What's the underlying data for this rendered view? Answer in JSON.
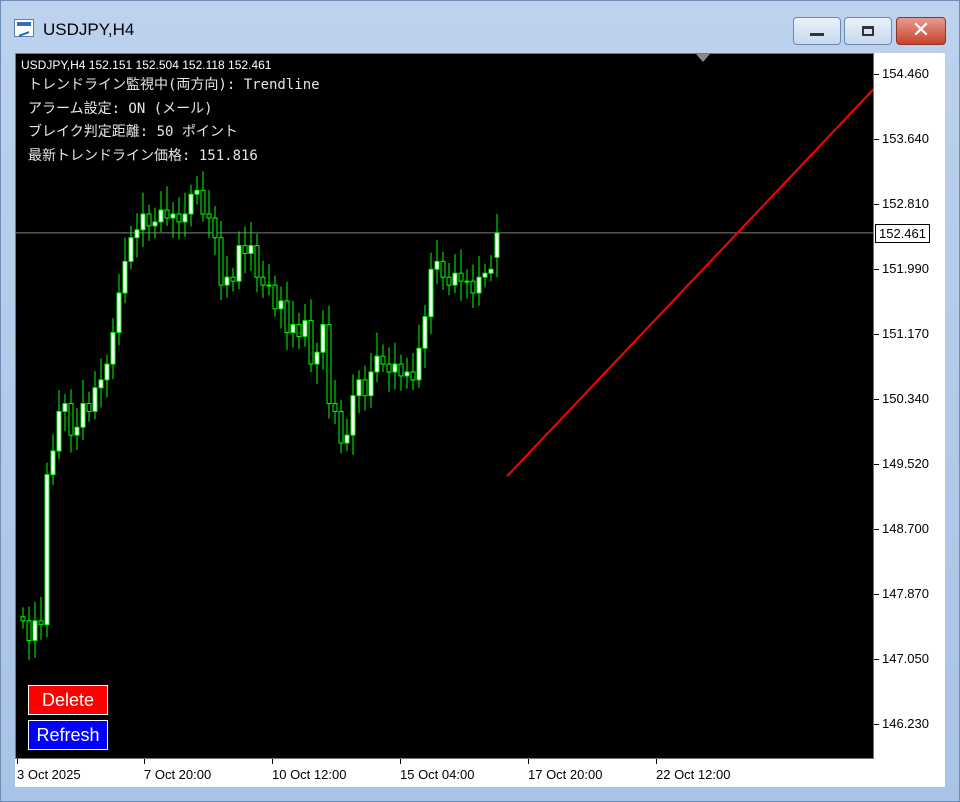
{
  "window": {
    "title": "USDJPY,H4",
    "close_glyph": "✕"
  },
  "chart": {
    "header": "USDJPY,H4  152.151 152.504 152.118 152.461",
    "info_lines": [
      "トレンドライン監視中(両方向): Trendline",
      "アラーム設定: ON (メール)",
      "ブレイク判定距離: 50 ポイント",
      "最新トレンドライン価格: 151.816"
    ],
    "buttons": {
      "delete": "Delete",
      "refresh": "Refresh"
    },
    "price_labels": [
      "154.460",
      "153.640",
      "152.810",
      "152.461",
      "151.990",
      "151.170",
      "150.340",
      "149.520",
      "148.700",
      "147.870",
      "147.050",
      "146.230"
    ],
    "current_price": "152.461",
    "time_labels": [
      "3 Oct 2025",
      "7 Oct 20:00",
      "10 Oct 12:00",
      "15 Oct 04:00",
      "17 Oct 20:00",
      "22 Oct 12:00"
    ],
    "colors": {
      "background": "#000000",
      "candle": "#00ff00",
      "bull_body": "#ffffff",
      "trendline": "#ff0000",
      "price_line": "#808080"
    }
  },
  "chart_data": {
    "type": "candlestick",
    "symbol": "USDJPY",
    "timeframe": "H4",
    "ohlc_last": {
      "open": 152.151,
      "high": 152.504,
      "low": 152.118,
      "close": 152.461
    },
    "ylim": [
      146.0,
      154.6
    ],
    "closes": [
      147.55,
      147.3,
      147.55,
      147.5,
      149.4,
      149.7,
      150.2,
      150.3,
      149.9,
      150.0,
      150.3,
      150.2,
      150.5,
      150.6,
      150.8,
      151.2,
      151.7,
      152.1,
      152.4,
      152.5,
      152.7,
      152.55,
      152.6,
      152.75,
      152.65,
      152.7,
      152.6,
      152.7,
      152.95,
      153.0,
      152.7,
      152.65,
      152.4,
      151.8,
      151.9,
      151.85,
      152.3,
      152.2,
      152.3,
      151.9,
      151.8,
      151.8,
      151.5,
      151.6,
      151.2,
      151.3,
      151.15,
      151.35,
      150.8,
      150.95,
      151.3,
      150.3,
      150.2,
      149.8,
      149.9,
      150.4,
      150.6,
      150.4,
      150.7,
      150.9,
      150.8,
      150.7,
      150.8,
      150.65,
      150.7,
      150.6,
      151.0,
      151.4,
      152.0,
      152.1,
      151.9,
      151.8,
      151.95,
      151.85,
      151.85,
      151.7,
      151.9,
      151.95,
      152.0,
      152.461
    ],
    "trendline": {
      "name": "Trendline",
      "start": 149.38,
      "end": 154.3,
      "current_value": 151.816
    }
  }
}
